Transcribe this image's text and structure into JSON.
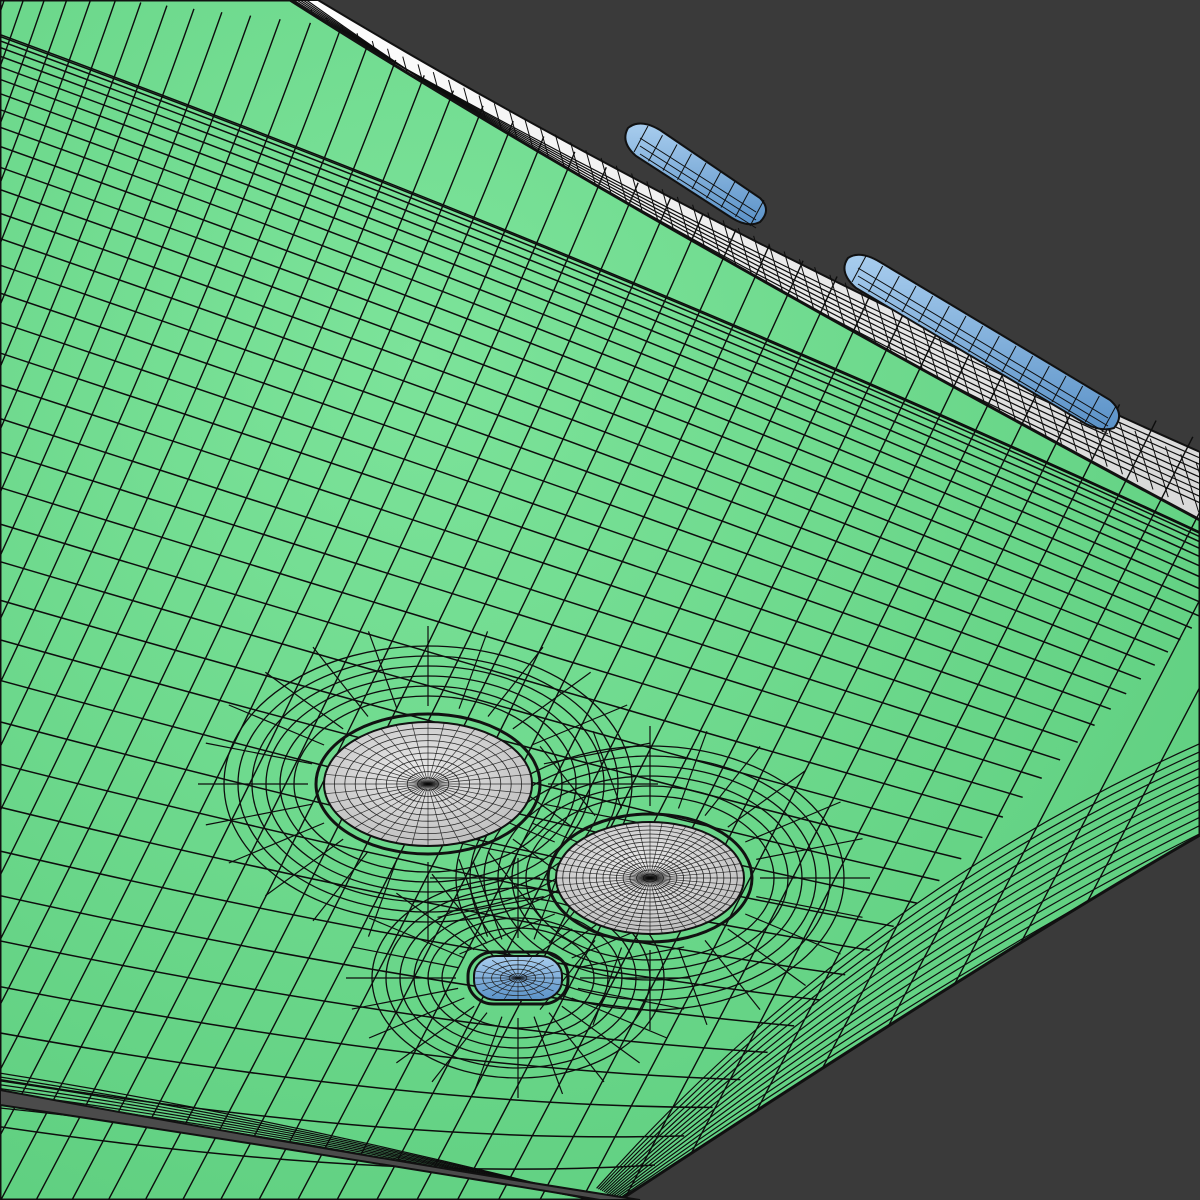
{
  "scene": {
    "background_color": "#3a3a3a",
    "surface_color": "#6ed98e",
    "surface_shade_color": "#4fae6a",
    "edge_color": "#f2f2f2",
    "edge_shade_color": "#cfcfcf",
    "wire_color": "#0d0d0d",
    "lens_color": "#dadada",
    "lens_inner_color": "#c9c9c9",
    "button_color": "#7fb3e0",
    "button_shade_color": "#4d86bd"
  },
  "objects": {
    "back_panel": "phone-back-panel",
    "side_edge": "phone-side-edge",
    "side_buttons": [
      "volume-button-top",
      "volume-button-bottom"
    ],
    "camera_lenses": [
      "camera-lens-primary",
      "camera-lens-secondary"
    ],
    "flash": "camera-flash"
  }
}
